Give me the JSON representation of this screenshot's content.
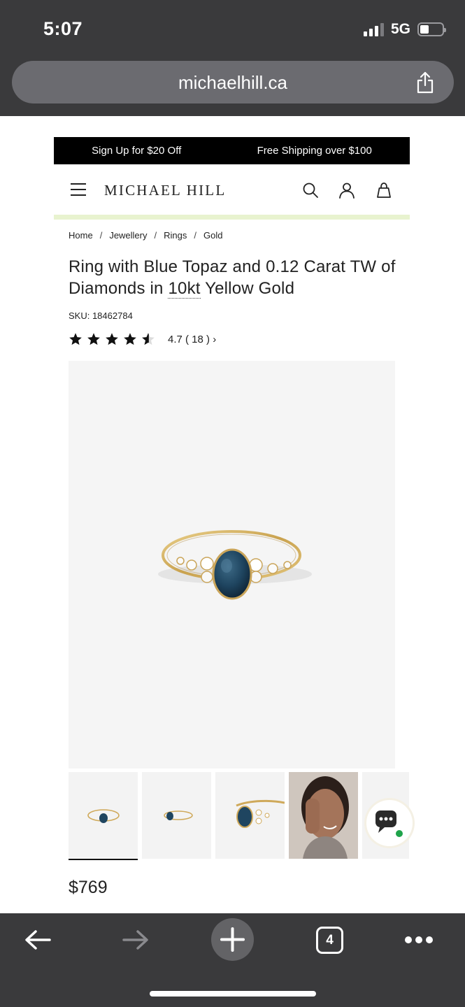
{
  "status_bar": {
    "time": "5:07",
    "network": "5G"
  },
  "browser": {
    "url": "michaelhill.ca",
    "tab_count": "4"
  },
  "promo": {
    "left": "Sign Up for $20 Off",
    "right": "Free Shipping over $100"
  },
  "header": {
    "logo": "MICHAEL HILL"
  },
  "breadcrumb": [
    "Home",
    "Jewellery",
    "Rings",
    "Gold"
  ],
  "product": {
    "title_part1": "Ring with Blue Topaz and 0.12 Carat TW of Diamonds in ",
    "title_karat": "10kt",
    "title_part2": " Yellow Gold",
    "sku": "SKU: 18462784",
    "rating": 4.7,
    "rating_text": "4.7 ( 18 ) ›",
    "price": "$769"
  },
  "colors": {
    "chrome": "#3a3a3c",
    "promo_bg": "#000000",
    "accent_strip": "#e8f3cf",
    "chat_dot": "#1fa34a"
  }
}
